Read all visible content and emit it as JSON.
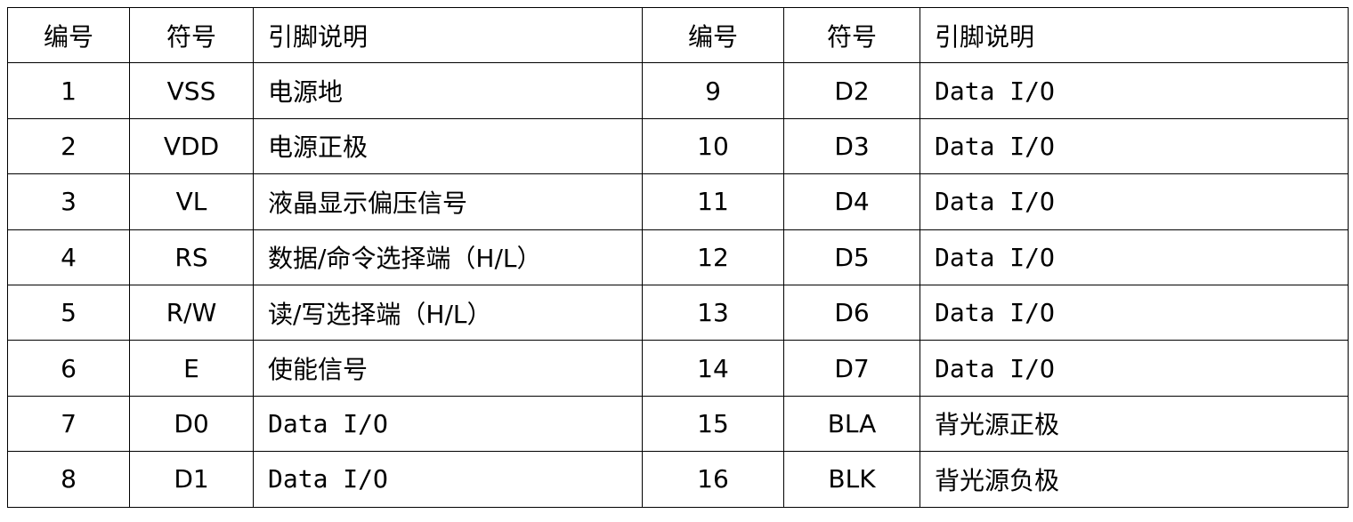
{
  "header": {
    "number": "编号",
    "symbol": "符号",
    "description": "引脚说明"
  },
  "rows": [
    {
      "left": {
        "number": "1",
        "symbol": "VSS",
        "description": "电源地"
      },
      "right": {
        "number": "9",
        "symbol": "D2",
        "description": "Data I/O"
      }
    },
    {
      "left": {
        "number": "2",
        "symbol": "VDD",
        "description": "电源正极"
      },
      "right": {
        "number": "10",
        "symbol": "D3",
        "description": "Data I/O"
      }
    },
    {
      "left": {
        "number": "3",
        "symbol": "VL",
        "description": "液晶显示偏压信号"
      },
      "right": {
        "number": "11",
        "symbol": "D4",
        "description": "Data I/O"
      }
    },
    {
      "left": {
        "number": "4",
        "symbol": "RS",
        "description": "数据/命令选择端（H/L）"
      },
      "right": {
        "number": "12",
        "symbol": "D5",
        "description": "Data I/O"
      }
    },
    {
      "left": {
        "number": "5",
        "symbol": "R/W",
        "description": "读/写选择端（H/L）"
      },
      "right": {
        "number": "13",
        "symbol": "D6",
        "description": "Data I/O"
      }
    },
    {
      "left": {
        "number": "6",
        "symbol": "E",
        "description": "使能信号"
      },
      "right": {
        "number": "14",
        "symbol": "D7",
        "description": "Data I/O"
      }
    },
    {
      "left": {
        "number": "7",
        "symbol": "D0",
        "description": "Data I/O"
      },
      "right": {
        "number": "15",
        "symbol": "BLA",
        "description": "背光源正极"
      }
    },
    {
      "left": {
        "number": "8",
        "symbol": "D1",
        "description": "Data I/O"
      },
      "right": {
        "number": "16",
        "symbol": "BLK",
        "description": "背光源负极"
      }
    }
  ]
}
